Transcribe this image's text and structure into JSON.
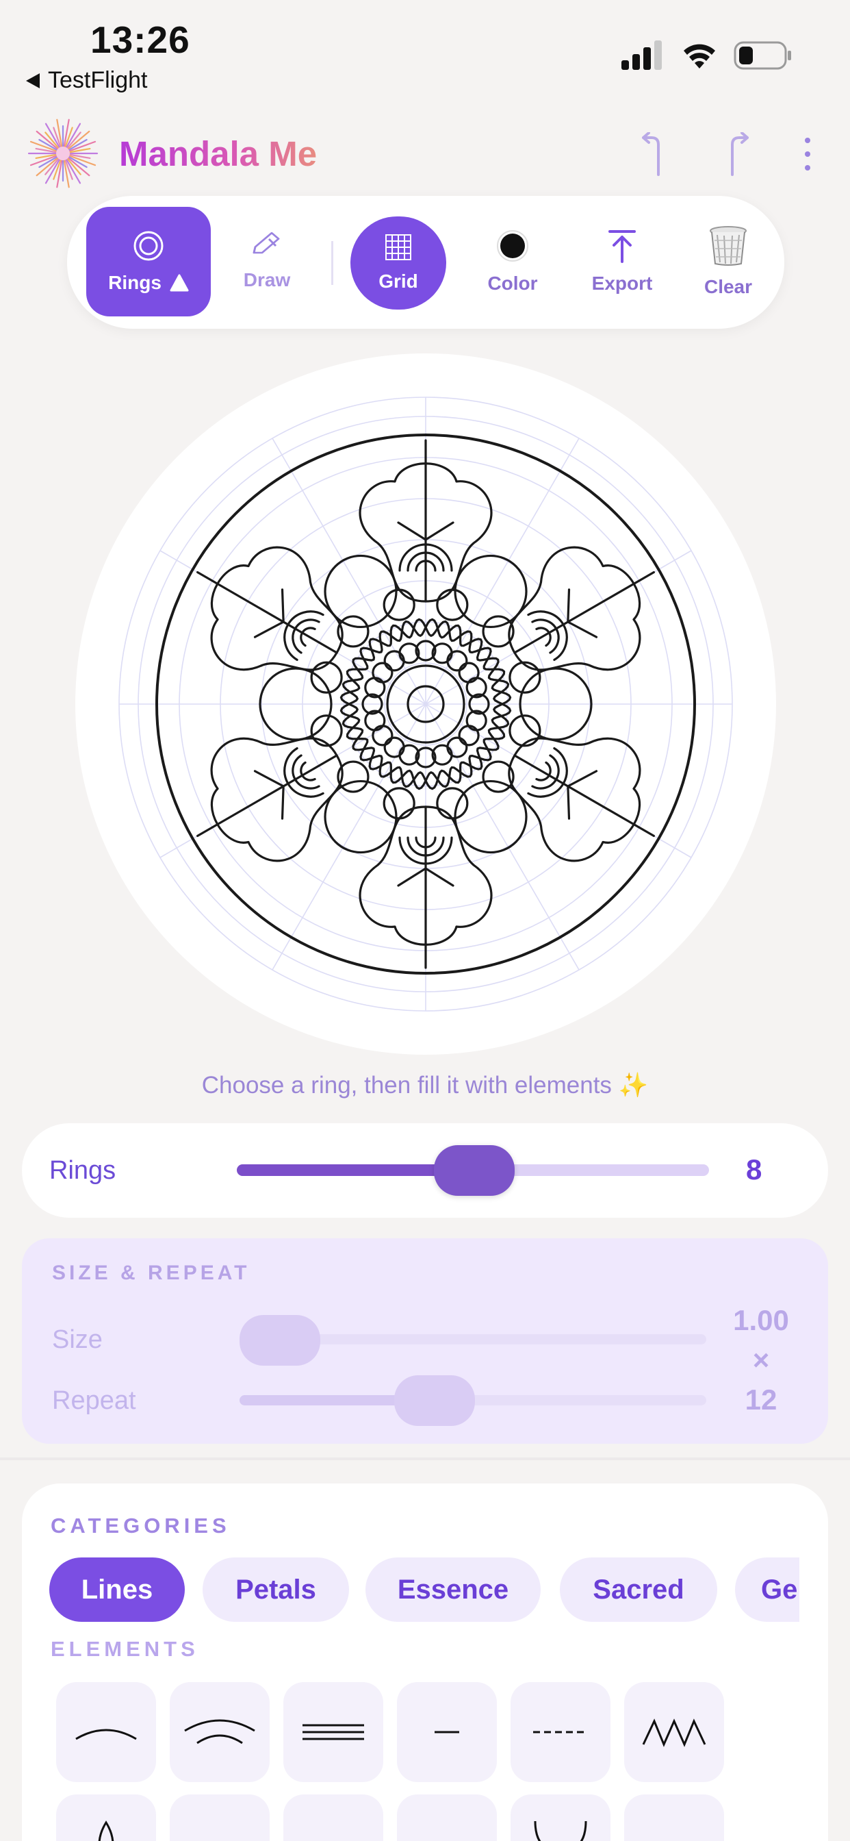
{
  "status_bar": {
    "time": "13:26",
    "back_app": "TestFlight"
  },
  "header": {
    "app_title": "Mandala Me"
  },
  "toolbar": {
    "items": [
      {
        "label": "Rings",
        "icon": "rings-icon",
        "active": true,
        "badge": "warning-triangle"
      },
      {
        "label": "Draw",
        "icon": "pencil-icon",
        "active": false
      },
      {
        "label": "Grid",
        "icon": "grid-icon",
        "active": true
      },
      {
        "label": "Color",
        "icon": "color-dot-icon",
        "active": false
      },
      {
        "label": "Export",
        "icon": "export-icon",
        "active": false
      },
      {
        "label": "Clear",
        "icon": "trash-icon",
        "active": false
      }
    ]
  },
  "canvas": {
    "hint": "Choose a ring, then fill it with elements ✨"
  },
  "rings": {
    "label": "Rings",
    "value": "8"
  },
  "size_repeat": {
    "title": "SIZE & REPEAT",
    "size_label": "Size",
    "repeat_label": "Repeat",
    "size_value": "1.00",
    "times": "×",
    "repeat_value": "12"
  },
  "categories": {
    "title": "CATEGORIES",
    "items": [
      "Lines",
      "Petals",
      "Essence",
      "Sacred",
      "Ge"
    ],
    "selected": "Lines"
  },
  "elements": {
    "title": "ELEMENTS",
    "tiles": [
      "arc-line-icon",
      "double-arc-icon",
      "triple-line-icon",
      "short-dash-icon",
      "dashed-line-icon",
      "zigzag-icon",
      "teardrop-icon",
      "scallop-chain-icon",
      "bead-chain-icon",
      "blank-icon",
      "cup-arc-icon",
      "blank-icon"
    ]
  },
  "colors": {
    "accent": "#7b4ee3",
    "accent_light": "#f0ebfc",
    "hint": "#9a86d6"
  }
}
